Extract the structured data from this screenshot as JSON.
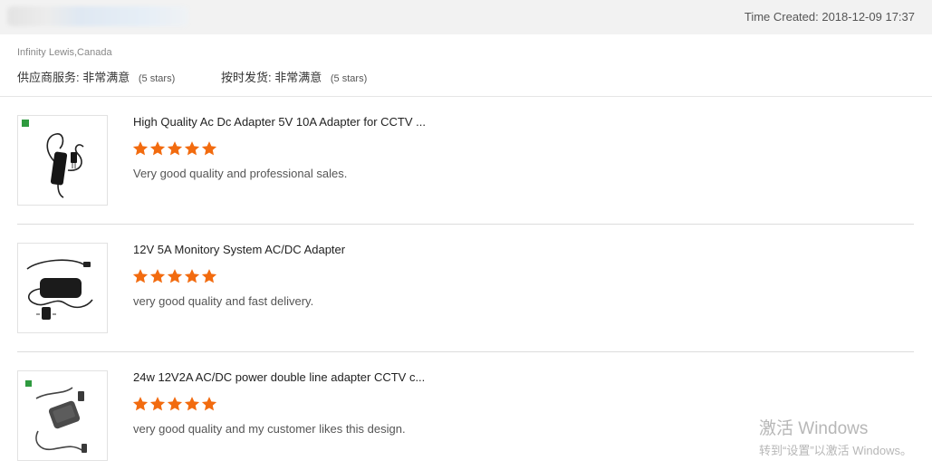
{
  "header": {
    "time_created": "Time Created: 2018-12-09 17:37"
  },
  "feedback": {
    "buyer": "Infinity Lewis,Canada",
    "supplier_service": {
      "label": "供应商服务:",
      "value": "非常满意",
      "note": "(5 stars)",
      "stars": 5
    },
    "on_time_shipment": {
      "label": "按时发货:",
      "value": "非常满意",
      "note": "(5 stars)",
      "stars": 5
    }
  },
  "accent_color": "#f26b0f",
  "products": [
    {
      "title": "High Quality Ac Dc Adapter 5V 10A Adapter for CCTV ...",
      "rating": 5,
      "comment": "Very good quality and professional sales.",
      "thumbnail_icon": "power-adapter-icon"
    },
    {
      "title": "12V 5A Monitory System AC/DC Adapter",
      "rating": 5,
      "comment": "very good quality and fast delivery.",
      "thumbnail_icon": "power-adapter-icon"
    },
    {
      "title": "24w 12V2A AC/DC power double line adapter CCTV c...",
      "rating": 5,
      "comment": "very good quality and my customer likes this design.",
      "thumbnail_icon": "power-adapter-icon"
    }
  ],
  "os_watermark": {
    "title": "激活 Windows",
    "subtitle": "转到“设置”以激活 Windows。"
  }
}
